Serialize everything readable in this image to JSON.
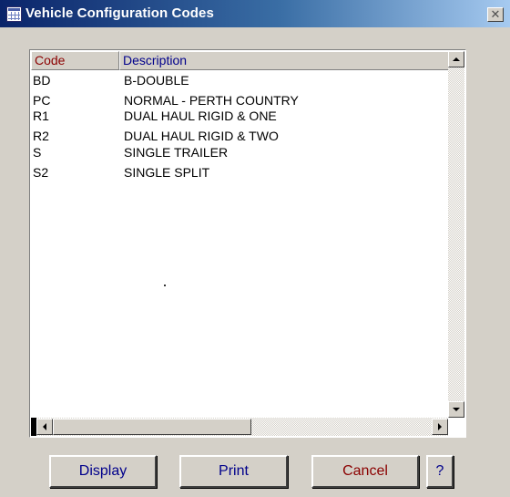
{
  "window": {
    "title": "Vehicle Configuration Codes",
    "close_label": "✕"
  },
  "table": {
    "columns": [
      "Code",
      "Description"
    ],
    "rows": [
      {
        "code": "BD",
        "description": "B-DOUBLE"
      },
      {
        "code": "PC",
        "description": "NORMAL - PERTH COUNTRY"
      },
      {
        "code": "R1",
        "description": "DUAL HAUL RIGID & ONE"
      },
      {
        "code": "R2",
        "description": "DUAL HAUL RIGID & TWO"
      },
      {
        "code": "S",
        "description": "SINGLE TRAILER"
      },
      {
        "code": "S2",
        "description": "SINGLE SPLIT"
      }
    ]
  },
  "buttons": {
    "display": "Display",
    "print": "Print",
    "cancel": "Cancel",
    "help": "?"
  },
  "colors": {
    "title_bar_start": "#0a246a",
    "title_bar_end": "#a6caf0",
    "dialog_background": "#d4d0c8",
    "code_header_text": "#8b0000",
    "description_header_text": "#00008b",
    "cancel_text": "#8b0000",
    "button_text": "#00008b"
  }
}
